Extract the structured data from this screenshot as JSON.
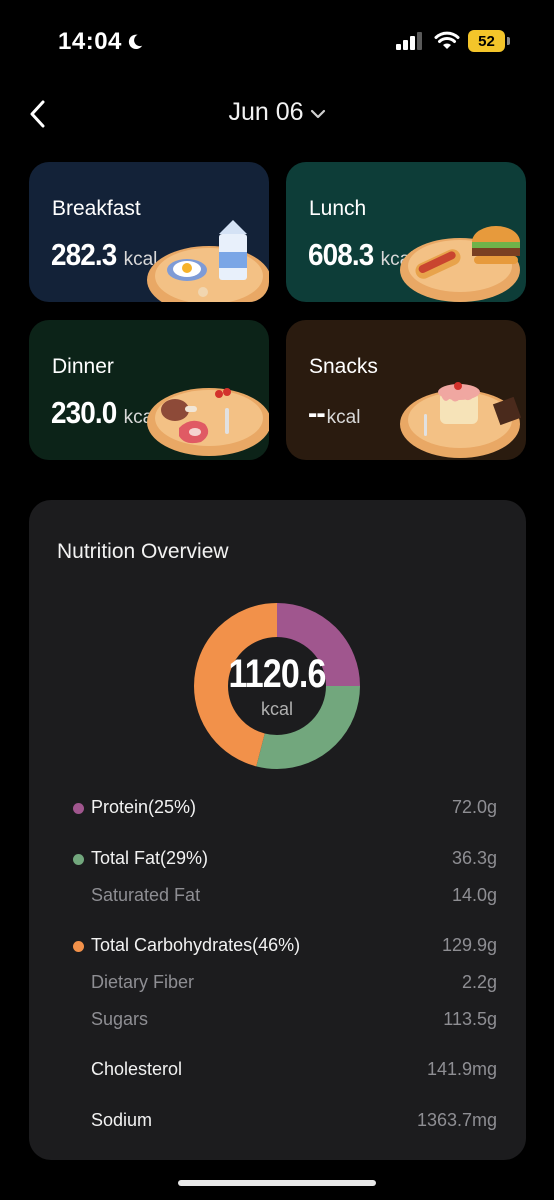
{
  "status": {
    "time": "14:04",
    "battery": "52"
  },
  "header": {
    "date": "Jun 06"
  },
  "meals": [
    {
      "name": "Breakfast",
      "value": "282.3",
      "unit": "kcal"
    },
    {
      "name": "Lunch",
      "value": "608.3",
      "unit": "kcal"
    },
    {
      "name": "Dinner",
      "value": "230.0",
      "unit": "kcal"
    },
    {
      "name": "Snacks",
      "value": "--",
      "unit": "kcal"
    }
  ],
  "nutrition": {
    "title": "Nutrition Overview",
    "total": "1120.6",
    "unit": "kcal",
    "rows": [
      {
        "label": "Protein(25%)",
        "amount": "72.0g"
      },
      {
        "label": "Total Fat(29%)",
        "amount": "36.3g"
      },
      {
        "label": "Saturated Fat",
        "amount": "14.0g"
      },
      {
        "label": "Total Carbohydrates(46%)",
        "amount": "129.9g"
      },
      {
        "label": "Dietary Fiber",
        "amount": "2.2g"
      },
      {
        "label": "Sugars",
        "amount": "113.5g"
      },
      {
        "label": "Cholesterol",
        "amount": "141.9mg"
      },
      {
        "label": "Sodium",
        "amount": "1363.7mg"
      }
    ],
    "breakdown": [
      {
        "name": "Protein",
        "percent": 25,
        "color": "#a0568e"
      },
      {
        "name": "Total Fat",
        "percent": 29,
        "color": "#72a77d"
      },
      {
        "name": "Total Carbohydrates",
        "percent": 46,
        "color": "#f2914a"
      }
    ]
  }
}
